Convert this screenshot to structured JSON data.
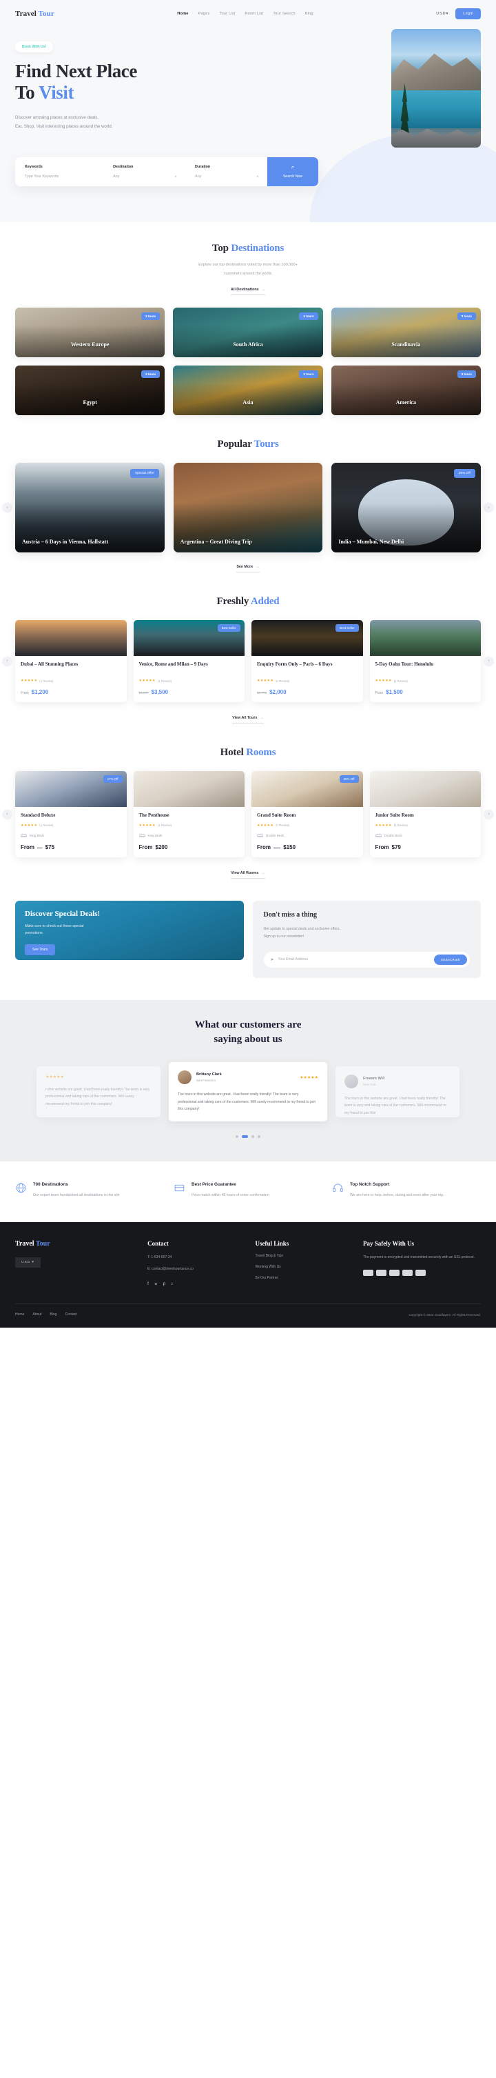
{
  "header": {
    "logo_main": "Travel",
    "logo_accent": "Tour",
    "nav": [
      {
        "label": "Home",
        "active": true
      },
      {
        "label": "Pages",
        "active": false
      },
      {
        "label": "Tour List",
        "active": false
      },
      {
        "label": "Room List",
        "active": false
      },
      {
        "label": "Tour Search",
        "active": false
      },
      {
        "label": "Blog",
        "active": false
      }
    ],
    "currency": "USD",
    "currency_caret": "▾",
    "login_label": "Login"
  },
  "hero": {
    "pill": "Book With Us!",
    "title_line1": "Find Next Place",
    "title_line2_plain": "To ",
    "title_line2_accent": "Visit",
    "sub_line1": "Discover amzaing places at exclusive deals.",
    "sub_line2": "Eat, Shop, Visit interesting places around the world.",
    "search": {
      "keywords_label": "Keywords",
      "keywords_placeholder": "Type Your Keywords",
      "destination_label": "Destination",
      "destination_value": "Any",
      "duration_label": "Duration",
      "duration_value": "Any",
      "button_label": "Search Now",
      "button_icon": "search-icon"
    }
  },
  "destinations": {
    "title_plain": "Top ",
    "title_accent": "Destinations",
    "desc_line1": "Explore our top destinations voted by more than 100,000+",
    "desc_line2": "customers around the world.",
    "link": "All Destinations",
    "arrow": "→",
    "items": [
      {
        "name": "Western Europe",
        "badge": "3 tours"
      },
      {
        "name": "South Africa",
        "badge": "3 tours"
      },
      {
        "name": "Scandinavia",
        "badge": "3 tours"
      },
      {
        "name": "Egypt",
        "badge": "3 tours"
      },
      {
        "name": "Asia",
        "badge": "3 tours"
      },
      {
        "name": "America",
        "badge": "3 tours"
      }
    ]
  },
  "popular_tours": {
    "title_plain": "Popular ",
    "title_accent": "Tours",
    "link": "See More",
    "arrow": "→",
    "prev_icon": "chevron-left-icon",
    "next_icon": "chevron-right-icon",
    "items": [
      {
        "title": "Austria – 6 Days in Vienna, Hallstatt",
        "badge": "Special Offer"
      },
      {
        "title": "Argentina – Great Diving Trip",
        "badge": ""
      },
      {
        "title": "India – Mumbai, New Delhi",
        "badge": "25% Off"
      }
    ]
  },
  "freshly_added": {
    "title_plain": "Freshly ",
    "title_accent": "Added",
    "link": "View All Tours",
    "arrow": "→",
    "items": [
      {
        "title": "Dubai – All Stunning Places",
        "badge": "",
        "stars": "★★★★★",
        "reviews": "(1 Review)",
        "from_label": "From",
        "old_price": "",
        "price": "$1,200"
      },
      {
        "title": "Venice, Rome and Milan – 9 Days",
        "badge": "Best Seller",
        "stars": "★★★★★",
        "reviews": "(1 Review)",
        "from_label": "",
        "old_price": "$4,300",
        "price": "$3,500"
      },
      {
        "title": "Enquiry Form Only – Paris – 6 Days",
        "badge": "Best Seller",
        "stars": "★★★★★",
        "reviews": "(1 Review)",
        "from_label": "",
        "old_price": "$3,700",
        "price": "$2,000"
      },
      {
        "title": "5-Day Oahu Tour: Honolulu",
        "badge": "",
        "stars": "★★★★★",
        "reviews": "(1 Review)",
        "from_label": "From",
        "old_price": "",
        "price": "$1,500"
      }
    ]
  },
  "hotel_rooms": {
    "title_plain": "Hotel ",
    "title_accent": "Rooms",
    "link": "View All Rooms",
    "arrow": "→",
    "items": [
      {
        "title": "Standard Deluxe",
        "badge": "17% Off",
        "stars": "★★★★★",
        "reviews": "(1 Review)",
        "bed": "King Beds",
        "from_label": "From",
        "old_price": "$90",
        "price": "$75"
      },
      {
        "title": "The Penthouse",
        "badge": "",
        "stars": "★★★★★",
        "reviews": "(1 Review)",
        "bed": "King Beds",
        "from_label": "From",
        "old_price": "",
        "price": "$200"
      },
      {
        "title": "Grand Suite Room",
        "badge": "25% Off",
        "stars": "★★★★★",
        "reviews": "(1 Review)",
        "bed": "Double Beds",
        "from_label": "From",
        "old_price": "$200",
        "price": "$150"
      },
      {
        "title": "Junior Suite Room",
        "badge": "",
        "stars": "★★★★★",
        "reviews": "(1 Review)",
        "bed": "Double Beds",
        "from_label": "From",
        "old_price": "",
        "price": "$79"
      }
    ]
  },
  "deals": {
    "title": "Discover Special Deals!",
    "text": "Make sure to check out these special promotions",
    "button": "See Tours"
  },
  "newsletter": {
    "title": "Don't miss a thing",
    "line1": "Get update to special deals and exclusive offers.",
    "line2": "Sign up to our newsletter!",
    "placeholder": "Your Email Address",
    "button": "SUBSCRIBE",
    "icon": "paper-plane-icon"
  },
  "testimonials": {
    "heading_line1": "What our customers are",
    "heading_line2": "saying about us",
    "left": {
      "text": "n this website are great. I had been really friendly! The team is very professional and taking care of the customers. Will surely recommend my freind to join this company!",
      "stars": "★★★★★"
    },
    "center": {
      "name": "Brittany Clark",
      "role": "San Francisco",
      "stars": "★★★★★",
      "text": "The tours in this website are great. I had been really friendly! The team is very professional and taking care of the customers. Will surely recommend to my freind to join this company!"
    },
    "right": {
      "name": "Freeem Will",
      "role": "New York",
      "text": "The tours in this website are great. I had been really friendly! The team is very and taking care of the customers. Will recommend to my freind to join this"
    },
    "dots": 4,
    "active_dot": 1
  },
  "features": [
    {
      "icon": "globe-icon",
      "title": "700 Destinations",
      "desc": "Our expert team handpicked all destinations in this site"
    },
    {
      "icon": "tag-icon",
      "title": "Best Price Guarantee",
      "desc": "Price match within 48 hours of order confirmation"
    },
    {
      "icon": "support-icon",
      "title": "Top Notch Support",
      "desc": "We are here to help, before, during and even after your trip."
    }
  ],
  "footer": {
    "logo_main": "Travel",
    "logo_accent": "Tour",
    "currency": "USD",
    "currency_caret": "▾",
    "contact": {
      "heading": "Contact",
      "phone": "T: 1-634-667-34",
      "email": "E: contact@tneelsourtance.co",
      "socials": [
        "facebook-icon",
        "twitter-icon",
        "pinterest-icon",
        "tiktok-icon"
      ]
    },
    "useful": {
      "heading": "Useful Links",
      "links": [
        "Travel Blog & Tips",
        "Working With Us",
        "Be Our Partner"
      ]
    },
    "pay": {
      "heading": "Pay Safely With Us",
      "desc": "The payment is encrypted and transmitted securely with an SSL protocol.",
      "cards": [
        "visa",
        "mastercard",
        "amex",
        "discover",
        "paypal"
      ]
    },
    "bottom_links": [
      "Home",
      "About",
      "Blog",
      "Contact"
    ],
    "copyright": "Copyright © 2022 Goodlayers. All Rights Reserved."
  }
}
